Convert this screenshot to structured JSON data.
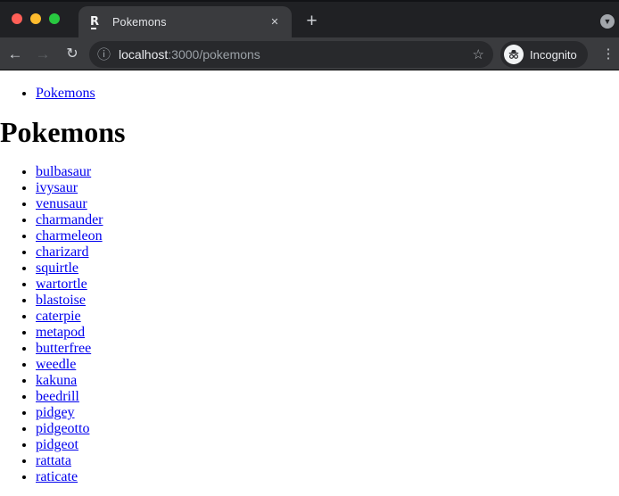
{
  "browser": {
    "traffic_lights": {
      "close_color": "#ff5f57",
      "minimize_color": "#febc2e",
      "zoom_color": "#28c840"
    },
    "tab": {
      "favicon": "remix-logo-icon",
      "title": "Pokemons",
      "close_glyph": "✕"
    },
    "new_tab_glyph": "+",
    "tab_overview_glyph": "▼",
    "toolbar": {
      "back_glyph": "←",
      "forward_glyph": "→",
      "reload_glyph": "↻",
      "info_glyph": "ⓘ",
      "url_host": "localhost",
      "url_rest": ":3000/pokemons",
      "star_glyph": "☆",
      "incognito_label": "Incognito",
      "menu_glyph": "⋮"
    }
  },
  "page": {
    "nav_links": [
      "Pokemons"
    ],
    "heading": "Pokemons",
    "pokemon_links": [
      "bulbasaur",
      "ivysaur",
      "venusaur",
      "charmander",
      "charmeleon",
      "charizard",
      "squirtle",
      "wartortle",
      "blastoise",
      "caterpie",
      "metapod",
      "butterfree",
      "weedle",
      "kakuna",
      "beedrill",
      "pidgey",
      "pidgeotto",
      "pidgeot",
      "rattata",
      "raticate"
    ]
  },
  "colors": {
    "frame": "#202124",
    "toolbar": "#3a3b3e",
    "omnibox": "#28292c",
    "url_host_text": "#e8eaed",
    "url_secondary_text": "#9aa0a6",
    "page_link": "#0000EE"
  }
}
